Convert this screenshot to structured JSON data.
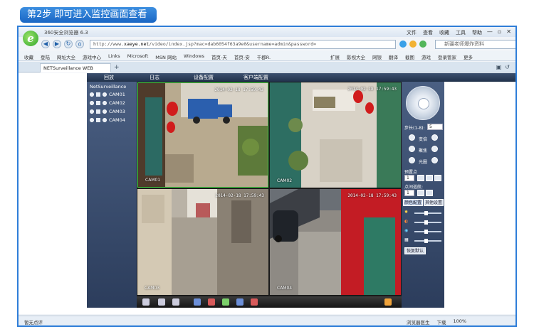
{
  "header": {
    "step_label": "第2步  即可进入监控画面查看"
  },
  "browser": {
    "logo_letter": "e",
    "title": "360安全浏览器 6.3",
    "menus": [
      "文件",
      "查看",
      "收藏",
      "工具",
      "帮助"
    ],
    "window_buttons": [
      "—",
      "▫",
      "✕"
    ],
    "url_domain": "xaeye.net",
    "url_prefix": "http://www.",
    "url_rest": "/video/index.jsp?mac=dab6054f63a9e0&username=admin&password=",
    "search_placeholder": "新疆老师爆炸资料",
    "favorites": [
      "收藏",
      "登陆",
      "网址大全",
      "游戏中心",
      "Links",
      "Microsoft",
      "MSN 网站",
      "Windows",
      "首页-天",
      "首页-安",
      "千郡R."
    ],
    "favorites_right": [
      "扩展",
      "影视大全",
      "网银",
      "翻译",
      "截图",
      "游戏",
      "登录管家",
      "更多"
    ],
    "tab_title": "NETSurveillance WEB",
    "tab_add": "+",
    "status_left": "暂无点评",
    "status_right": [
      "浏览器医生",
      "下载",
      "100%"
    ]
  },
  "app": {
    "menu": [
      "回放",
      "日志",
      "设备配置",
      "客户端配置"
    ],
    "tree_title": "NetSurveillance",
    "cameras": [
      "CAM01",
      "CAM02",
      "CAM03",
      "CAM04"
    ],
    "feeds": [
      {
        "timestamp": "2014-02-18 17:59:43",
        "label": "CAM01"
      },
      {
        "timestamp": "2014-02-18 17:59:43",
        "label": "CAM02"
      },
      {
        "timestamp": "2014-02-18 17:59:43",
        "label": "CAM03"
      },
      {
        "timestamp": "2014-02-18 17:59:43",
        "label": "CAM04"
      }
    ],
    "ptz": {
      "step_label": "步长(1-8):",
      "step_value": "5",
      "zoom_label": "变倍",
      "focus_label": "聚焦",
      "iris_label": "光圈",
      "preset_label": "预置点",
      "preset_value": "1",
      "tour_label": "点间巡航:",
      "tour_value": "1",
      "color_tab": "颜色配置",
      "other_tab": "其他设置",
      "default_button": "恢复默认"
    }
  }
}
